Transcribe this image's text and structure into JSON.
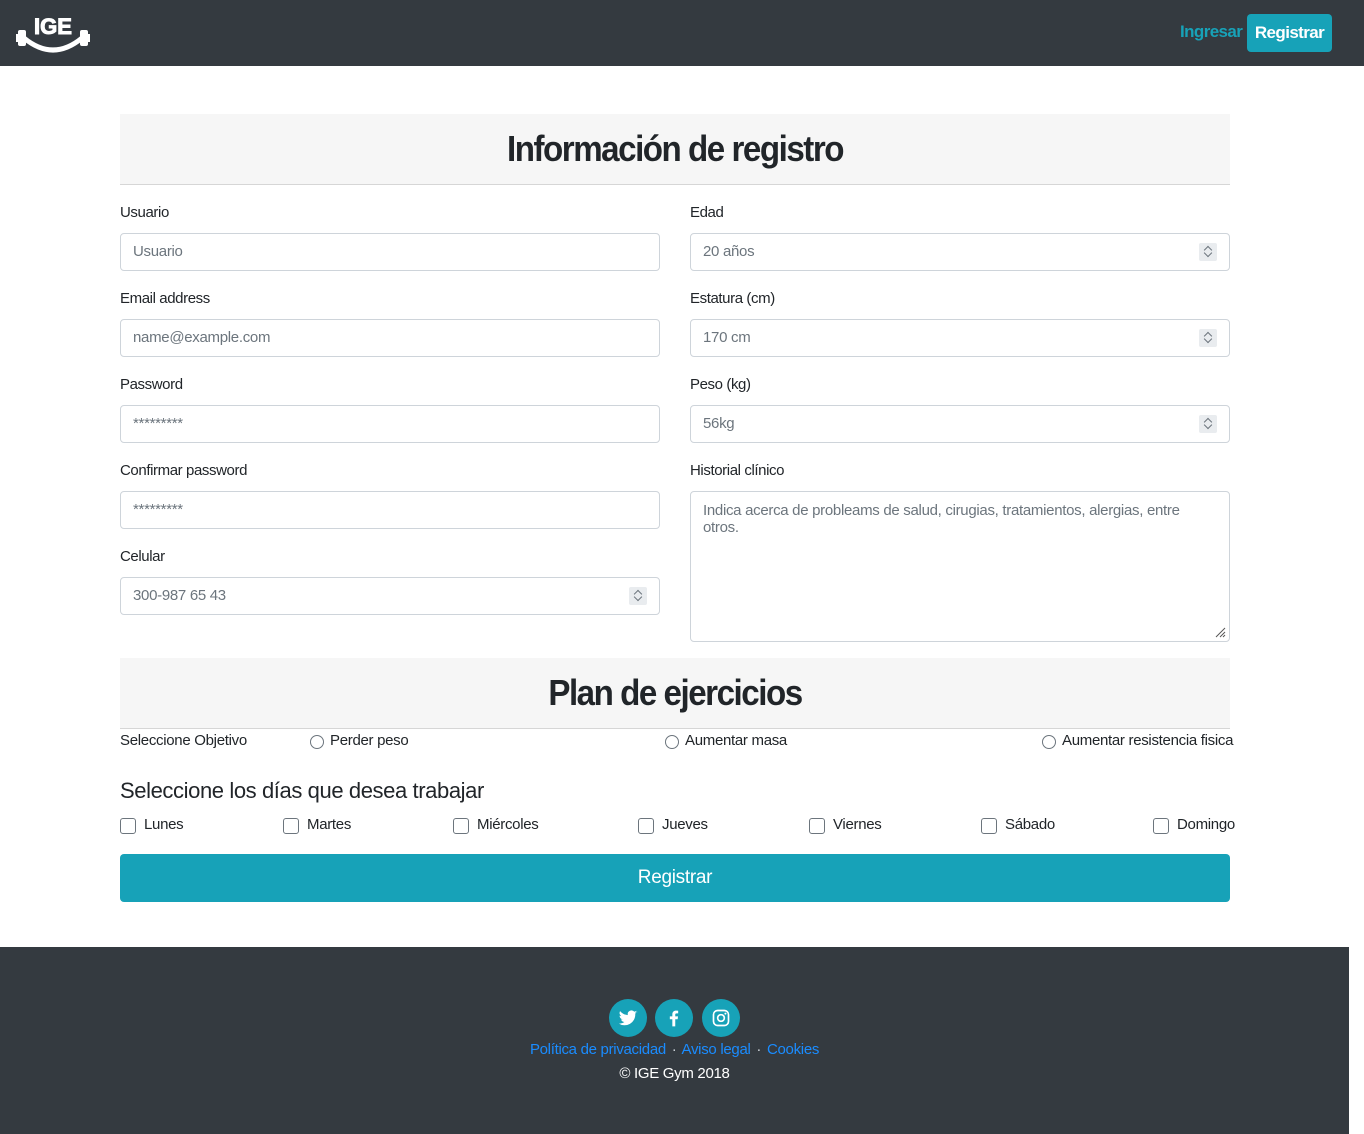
{
  "navbar": {
    "logo_text": "IGE",
    "login_label": "Ingresar",
    "register_label": "Registrar",
    "accent": "#17a2b8",
    "background": "#343a40"
  },
  "registration": {
    "title": "Información de registro",
    "usuario": {
      "label": "Usuario",
      "placeholder": "Usuario"
    },
    "email": {
      "label": "Email address",
      "placeholder": "name@example.com"
    },
    "password": {
      "label": "Password",
      "placeholder": "*********"
    },
    "confirm_password": {
      "label": "Confirmar password",
      "placeholder": "*********"
    },
    "celular": {
      "label": "Celular",
      "placeholder": "300-987 65 43"
    },
    "edad": {
      "label": "Edad",
      "placeholder": "20 años"
    },
    "estatura": {
      "label": "Estatura (cm)",
      "placeholder": "170 cm"
    },
    "peso": {
      "label": "Peso (kg)",
      "placeholder": "56kg"
    },
    "historial": {
      "label": "Historial clínico",
      "placeholder": "Indica acerca de probleams de salud, cirugias, tratamientos, alergias, entre otros."
    }
  },
  "plan": {
    "title": "Plan de ejercicios",
    "objective_label": "Seleccione Objetivo",
    "objectives": [
      "Perder peso",
      "Aumentar masa",
      "Aumentar resistencia fisica"
    ],
    "days_title": "Seleccione los días que desea trabajar",
    "days": [
      "Lunes",
      "Martes",
      "Miércoles",
      "Jueves",
      "Viernes",
      "Sábado",
      "Domingo"
    ],
    "submit_label": "Registrar"
  },
  "footer": {
    "social": [
      "twitter-icon",
      "facebook-icon",
      "instagram-icon"
    ],
    "links": [
      "Política de privacidad",
      "Aviso legal",
      "Cookies"
    ],
    "separator": "·",
    "copyright": "© IGE Gym 2018"
  }
}
